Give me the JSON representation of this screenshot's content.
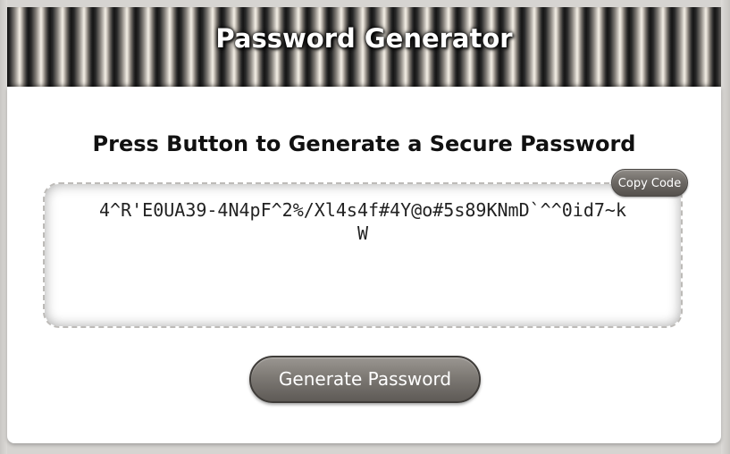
{
  "header": {
    "title": "Password Generator"
  },
  "main": {
    "subtitle": "Press Button to Generate a Secure Password",
    "password": "4^R'E0UA39-4N4pF^2%/Xl4s4f#4Y@o#5s89KNmD`^^0id7~kW",
    "copy_label": "Copy Code",
    "generate_label": "Generate Password"
  },
  "colors": {
    "button_gray": "#7d7974",
    "header_stripe_light": "#f4efe6",
    "header_stripe_dark": "#151515",
    "background": "#d6d4d1"
  },
  "icons": []
}
